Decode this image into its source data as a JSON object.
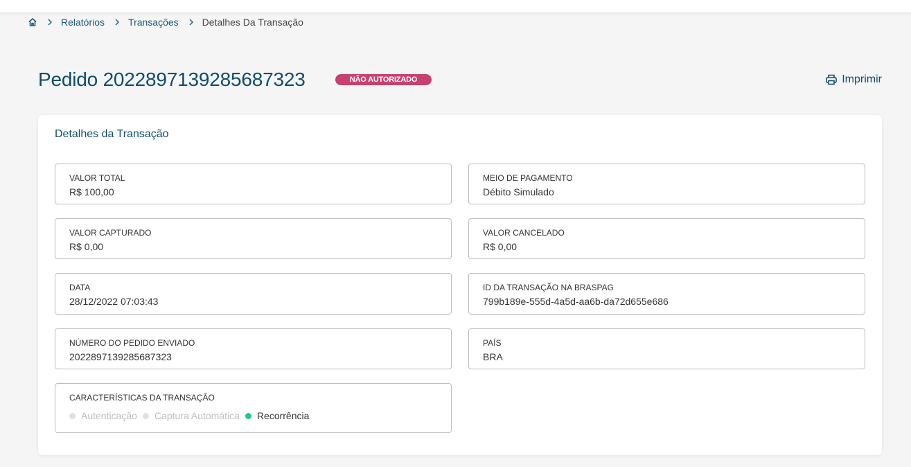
{
  "breadcrumb": {
    "items": [
      "Relatórios",
      "Transações"
    ],
    "current": "Detalhes Da Transação"
  },
  "header": {
    "title": "Pedido 2022897139285687323",
    "status_badge": "NÃO AUTORIZADO",
    "print_label": "Imprimir"
  },
  "card": {
    "title": "Detalhes da Transação",
    "fields": [
      {
        "label": "VALOR TOTAL",
        "value": "R$ 100,00"
      },
      {
        "label": "MEIO DE PAGAMENTO",
        "value": "Débito Simulado"
      },
      {
        "label": "VALOR CAPTURADO",
        "value": "R$ 0,00"
      },
      {
        "label": "VALOR CANCELADO",
        "value": "R$ 0,00"
      },
      {
        "label": "DATA",
        "value": "28/12/2022 07:03:43"
      },
      {
        "label": "ID DA TRANSAÇÃO NA BRASPAG",
        "value": "799b189e-555d-4a5d-aa6b-da72d655e686"
      },
      {
        "label": "NÚMERO DO PEDIDO ENVIADO",
        "value": "2022897139285687323"
      },
      {
        "label": "PAÍS",
        "value": "BRA"
      }
    ],
    "characteristics": {
      "label": "CARACTERÍSTICAS DA TRANSAÇÃO",
      "items": [
        {
          "label": "Autenticação",
          "active": false
        },
        {
          "label": "Captura Automática",
          "active": false
        },
        {
          "label": "Recorrência",
          "active": true
        }
      ]
    }
  },
  "colors": {
    "primary": "#0f4c6b",
    "link": "#1b5a7a",
    "badge": "#c8406e",
    "active_dot": "#1fc694",
    "inactive_dot": "#e0e0e0"
  },
  "icons": {
    "home": "home-icon",
    "separator": "chevron-right-icon",
    "print": "printer-icon"
  }
}
